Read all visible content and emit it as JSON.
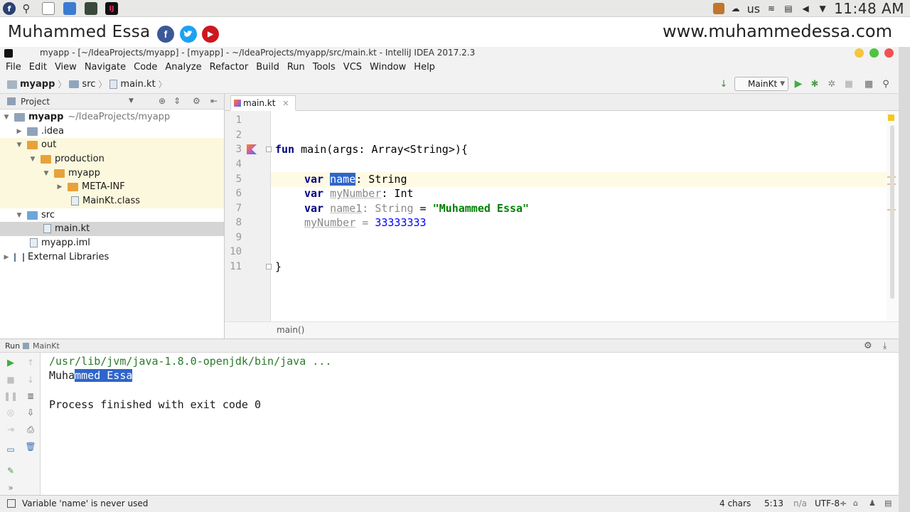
{
  "os_panel": {
    "keyboard_layout": "us",
    "clock": "11:48 AM"
  },
  "branding": {
    "name": "Muhammed Essa",
    "website": "www.muhammedessa.com",
    "social": {
      "facebook": "f",
      "youtube": "▶"
    }
  },
  "window": {
    "title": "myapp - [~/IdeaProjects/myapp] - [myapp] - ~/IdeaProjects/myapp/src/main.kt - IntelliJ IDEA 2017.2.3"
  },
  "menu": [
    "File",
    "Edit",
    "View",
    "Navigate",
    "Code",
    "Analyze",
    "Refactor",
    "Build",
    "Run",
    "Tools",
    "VCS",
    "Window",
    "Help"
  ],
  "navbar": {
    "breadcrumb": [
      "myapp",
      "src",
      "main.kt"
    ],
    "run_config": "MainKt"
  },
  "project_panel": {
    "title": "Project",
    "tree": [
      {
        "label": "myapp",
        "extra": "~/IdeaProjects/myapp"
      },
      {
        "label": ".idea"
      },
      {
        "label": "out"
      },
      {
        "label": "production"
      },
      {
        "label": "myapp"
      },
      {
        "label": "META-INF"
      },
      {
        "label": "MainKt.class"
      },
      {
        "label": "src"
      },
      {
        "label": "main.kt"
      },
      {
        "label": "myapp.iml"
      },
      {
        "label": "External Libraries"
      }
    ]
  },
  "editor": {
    "tab": "main.kt",
    "line_numbers": [
      "1",
      "2",
      "3",
      "4",
      "5",
      "6",
      "7",
      "8",
      "9",
      "10",
      "11"
    ],
    "code": {
      "l3": {
        "kw": "fun",
        "rest": " main(args: Array<String>){"
      },
      "l5": {
        "kw": "var",
        "name": "name",
        "rest": ": String"
      },
      "l6": {
        "kw": "var",
        "name": "myNumber",
        "rest": ": Int"
      },
      "l7": {
        "kw": "var",
        "name": "name1",
        "colon": ": ",
        "type": "String",
        "eq": " = ",
        "str": "\"Muhammed Essa\""
      },
      "l8": {
        "name": "myNumber",
        "eq": " = ",
        "num": "33333333"
      },
      "l11": "}"
    },
    "breadcrumb": "main()"
  },
  "run_panel": {
    "label": "Run",
    "tab": "MainKt",
    "console": {
      "command": "/usr/lib/jvm/java-1.8.0-openjdk/bin/java ...",
      "output_pre": "Muha",
      "output_sel": "mmed Essa",
      "exit": "Process finished with exit code 0"
    }
  },
  "statusbar": {
    "message": "Variable 'name' is never used",
    "chars": "4 chars",
    "position": "5:13",
    "na": "n/a",
    "encoding": "UTF-8÷"
  }
}
